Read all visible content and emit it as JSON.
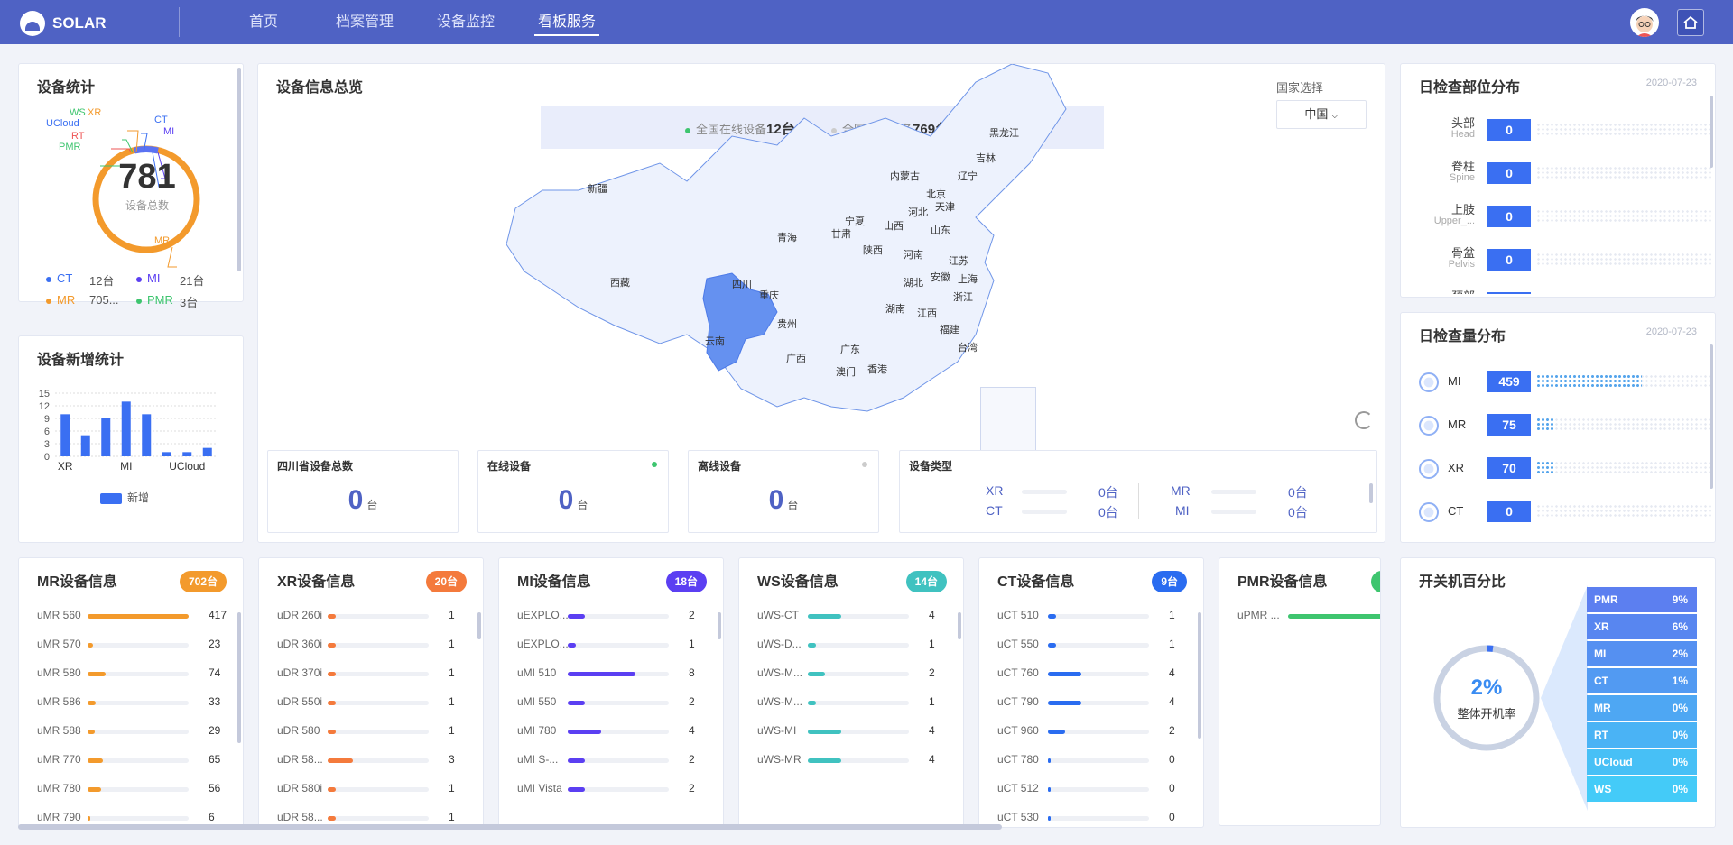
{
  "header": {
    "brand": "SOLAR",
    "nav": [
      "首页",
      "档案管理",
      "设备监控",
      "看板服务"
    ],
    "active_nav": "看板服务"
  },
  "device_stats": {
    "title": "设备统计",
    "total": "781",
    "total_label": "设备总数",
    "ring_labels": [
      "WS",
      "XR",
      "UCloud",
      "RT",
      "PMR",
      "CT",
      "MI",
      "MR"
    ],
    "legend": [
      {
        "name": "CT",
        "value": "12台",
        "color": "#3a6ff2"
      },
      {
        "name": "MI",
        "value": "21台",
        "color": "#5b3ff2"
      },
      {
        "name": "MR",
        "value": "705...",
        "color": "#f39a2c"
      },
      {
        "name": "PMR",
        "value": "3台",
        "color": "#3ec56f"
      }
    ]
  },
  "new_stats": {
    "title": "设备新增统计",
    "legend": "新增",
    "chart_data": {
      "type": "bar",
      "categories": [
        "XR",
        "",
        "MI",
        "",
        "UCloud",
        "",
        "",
        ""
      ],
      "x_tick_labels": [
        "XR",
        "MI",
        "UCloud"
      ],
      "values": [
        10,
        5,
        9,
        13,
        10,
        1,
        1,
        2
      ],
      "yticks": [
        "15",
        "12",
        "9",
        "6",
        "3",
        "0"
      ],
      "ylim": [
        0,
        15
      ],
      "series": [
        {
          "name": "新增",
          "values": [
            10,
            5,
            9,
            13,
            10,
            1,
            1,
            2
          ]
        }
      ]
    }
  },
  "overview": {
    "title": "设备信息总览",
    "online_text": "全国在线设备",
    "online_count": "12台",
    "offline_text": "全国离线设备",
    "offline_count": "769台",
    "country_label": "国家选择",
    "country_value": "中国",
    "provinces": [
      "黑龙江",
      "吉林",
      "辽宁",
      "内蒙古",
      "新疆",
      "北京",
      "天津",
      "河北",
      "宁夏",
      "山西",
      "山东",
      "青海",
      "甘肃",
      "陕西",
      "河南",
      "江苏",
      "西藏",
      "四川",
      "重庆",
      "湖北",
      "安徽",
      "上海",
      "浙江",
      "贵州",
      "湖南",
      "江西",
      "福建",
      "云南",
      "广西",
      "广东",
      "台湾",
      "香港",
      "澳门"
    ],
    "selected_province": "四川",
    "stats": [
      {
        "label": "四川省设备总数",
        "value": "0",
        "unit": "台"
      },
      {
        "label": "在线设备",
        "value": "0",
        "unit": "台"
      },
      {
        "label": "离线设备",
        "value": "0",
        "unit": "台"
      }
    ],
    "type_label": "设备类型",
    "types": [
      {
        "name": "XR",
        "value": "0台"
      },
      {
        "name": "CT",
        "value": "0台"
      },
      {
        "name": "MR",
        "value": "0台"
      },
      {
        "name": "MI",
        "value": "0台"
      }
    ]
  },
  "part_dist": {
    "title": "日检查部位分布",
    "date": "2020-07-23",
    "rows": [
      {
        "name": "头部",
        "sub": "Head",
        "value": "0"
      },
      {
        "name": "脊柱",
        "sub": "Spine",
        "value": "0"
      },
      {
        "name": "上肢",
        "sub": "Upper_...",
        "value": "0"
      },
      {
        "name": "骨盆",
        "sub": "Pelvis",
        "value": "0"
      },
      {
        "name": "颈部",
        "sub": "",
        "value": ""
      }
    ]
  },
  "volume_dist": {
    "title": "日检查量分布",
    "date": "2020-07-23",
    "rows": [
      {
        "name": "MI",
        "value": "459",
        "fraction": 0.6
      },
      {
        "name": "MR",
        "value": "75",
        "fraction": 0.1
      },
      {
        "name": "XR",
        "value": "70",
        "fraction": 0.1
      },
      {
        "name": "CT",
        "value": "0",
        "fraction": 0
      }
    ]
  },
  "device_cards": [
    {
      "title": "MR设备信息",
      "badge": "702台",
      "color": "#f39a2c",
      "max": 417,
      "rows": [
        [
          "uMR 560",
          "417"
        ],
        [
          "uMR 570",
          "23"
        ],
        [
          "uMR 580",
          "74"
        ],
        [
          "uMR 586",
          "33"
        ],
        [
          "uMR 588",
          "29"
        ],
        [
          "uMR 770",
          "65"
        ],
        [
          "uMR 780",
          "56"
        ],
        [
          "uMR 790",
          "6"
        ]
      ]
    },
    {
      "title": "XR设备信息",
      "badge": "20台",
      "color": "#f47a3c",
      "max": 12,
      "rows": [
        [
          "uDR 260i",
          "1"
        ],
        [
          "uDR 360i",
          "1"
        ],
        [
          "uDR 370i",
          "1"
        ],
        [
          "uDR 550i",
          "1"
        ],
        [
          "uDR 580",
          "1"
        ],
        [
          "uDR 58...",
          "3"
        ],
        [
          "uDR 580i",
          "1"
        ],
        [
          "uDR 58...",
          "1"
        ]
      ]
    },
    {
      "title": "MI设备信息",
      "badge": "18台",
      "color": "#5b3ff2",
      "max": 12,
      "rows": [
        [
          "uEXPLO...",
          "2"
        ],
        [
          "uEXPLO...",
          "1"
        ],
        [
          "uMI 510",
          "8"
        ],
        [
          "uMI 550",
          "2"
        ],
        [
          "uMI 780",
          "4"
        ],
        [
          "uMI S-...",
          "2"
        ],
        [
          "uMI Vista",
          "2"
        ]
      ]
    },
    {
      "title": "WS设备信息",
      "badge": "14台",
      "color": "#40c2c0",
      "max": 12,
      "rows": [
        [
          "uWS-CT",
          "4"
        ],
        [
          "uWS-D...",
          "1"
        ],
        [
          "uWS-M...",
          "2"
        ],
        [
          "uWS-M...",
          "1"
        ],
        [
          "uWS-MI",
          "4"
        ],
        [
          "uWS-MR",
          "4"
        ]
      ]
    },
    {
      "title": "CT设备信息",
      "badge": "9台",
      "color": "#2a6cf0",
      "max": 12,
      "rows": [
        [
          "uCT 510",
          "1"
        ],
        [
          "uCT 550",
          "1"
        ],
        [
          "uCT 760",
          "4"
        ],
        [
          "uCT 790",
          "4"
        ],
        [
          "uCT 960",
          "2"
        ],
        [
          "uCT 780",
          "0"
        ],
        [
          "uCT 512",
          "0"
        ],
        [
          "uCT 530",
          "0"
        ]
      ]
    },
    {
      "title": "PMR设备信息",
      "badge": "",
      "color": "#3ec56f",
      "max": 1,
      "rows": [
        [
          "uPMR ...",
          "1"
        ]
      ]
    }
  ],
  "power": {
    "title": "开关机百分比",
    "center_value": "2%",
    "center_label": "整体开机率",
    "rows": [
      {
        "name": "PMR",
        "value": "9%"
      },
      {
        "name": "XR",
        "value": "6%"
      },
      {
        "name": "MI",
        "value": "2%"
      },
      {
        "name": "CT",
        "value": "1%"
      },
      {
        "name": "MR",
        "value": "0%"
      },
      {
        "name": "RT",
        "value": "0%"
      },
      {
        "name": "UCloud",
        "value": "0%"
      },
      {
        "name": "WS",
        "value": "0%"
      }
    ]
  }
}
